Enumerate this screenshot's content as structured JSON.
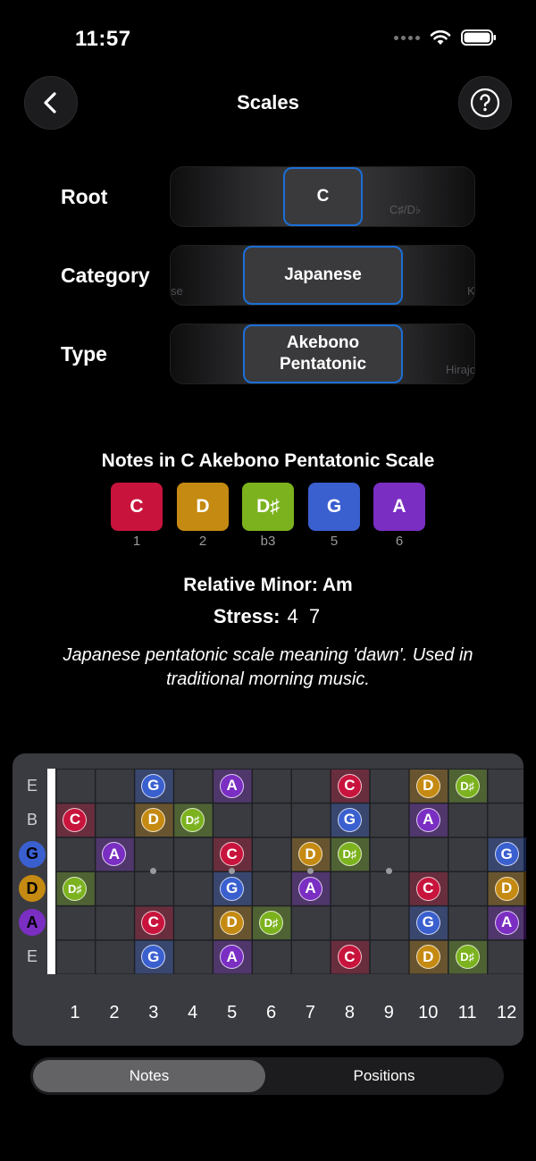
{
  "status": {
    "time": "11:57"
  },
  "nav": {
    "title": "Scales"
  },
  "pickers": [
    {
      "label": "Root",
      "value": "C",
      "next": "C♯/D♭"
    },
    {
      "label": "Category",
      "value": "Japanese",
      "prev": "se",
      "next": "K"
    },
    {
      "label": "Type",
      "value": "Akebono Pentatonic",
      "next": "Hirajoshi"
    }
  ],
  "scale": {
    "title": "Notes in C Akebono Pentatonic Scale",
    "notes": [
      {
        "name": "C",
        "interval": "1",
        "color": "#c8143c"
      },
      {
        "name": "D",
        "interval": "2",
        "color": "#c58a12"
      },
      {
        "name": "D♯",
        "interval": "b3",
        "color": "#7bb21e"
      },
      {
        "name": "G",
        "interval": "5",
        "color": "#3a5fcf"
      },
      {
        "name": "A",
        "interval": "6",
        "color": "#7a2ec2"
      }
    ],
    "relative_minor": "Relative Minor: Am",
    "stress_label": "Stress:",
    "stress_values": "4 7",
    "description": "Japanese pentatonic scale meaning 'dawn'. Used in traditional morning music."
  },
  "fretboard": {
    "strings": [
      "E",
      "B",
      "G",
      "D",
      "A",
      "E"
    ],
    "string_highlight": [
      false,
      false,
      true,
      true,
      true,
      false
    ],
    "fret_numbers": [
      "1",
      "2",
      "3",
      "4",
      "5",
      "6",
      "7",
      "8",
      "9",
      "10",
      "11",
      "12"
    ],
    "inlays": [
      3,
      5,
      7,
      9
    ],
    "positions": [
      {
        "string": 0,
        "fret": 3,
        "note": "G"
      },
      {
        "string": 0,
        "fret": 5,
        "note": "A"
      },
      {
        "string": 0,
        "fret": 8,
        "note": "C"
      },
      {
        "string": 0,
        "fret": 10,
        "note": "D"
      },
      {
        "string": 0,
        "fret": 11,
        "note": "D♯"
      },
      {
        "string": 1,
        "fret": 1,
        "note": "C"
      },
      {
        "string": 1,
        "fret": 3,
        "note": "D"
      },
      {
        "string": 1,
        "fret": 4,
        "note": "D♯"
      },
      {
        "string": 1,
        "fret": 8,
        "note": "G"
      },
      {
        "string": 1,
        "fret": 10,
        "note": "A"
      },
      {
        "string": 2,
        "fret": 2,
        "note": "A"
      },
      {
        "string": 2,
        "fret": 5,
        "note": "C"
      },
      {
        "string": 2,
        "fret": 7,
        "note": "D"
      },
      {
        "string": 2,
        "fret": 8,
        "note": "D♯"
      },
      {
        "string": 2,
        "fret": 12,
        "note": "G"
      },
      {
        "string": 3,
        "fret": 1,
        "note": "D♯"
      },
      {
        "string": 3,
        "fret": 5,
        "note": "G"
      },
      {
        "string": 3,
        "fret": 7,
        "note": "A"
      },
      {
        "string": 3,
        "fret": 10,
        "note": "C"
      },
      {
        "string": 3,
        "fret": 12,
        "note": "D"
      },
      {
        "string": 4,
        "fret": 3,
        "note": "C"
      },
      {
        "string": 4,
        "fret": 5,
        "note": "D"
      },
      {
        "string": 4,
        "fret": 6,
        "note": "D♯"
      },
      {
        "string": 4,
        "fret": 10,
        "note": "G"
      },
      {
        "string": 4,
        "fret": 12,
        "note": "A"
      },
      {
        "string": 5,
        "fret": 3,
        "note": "G"
      },
      {
        "string": 5,
        "fret": 5,
        "note": "A"
      },
      {
        "string": 5,
        "fret": 8,
        "note": "C"
      },
      {
        "string": 5,
        "fret": 10,
        "note": "D"
      },
      {
        "string": 5,
        "fret": 11,
        "note": "D♯"
      }
    ]
  },
  "segmented": {
    "notes_label": "Notes",
    "positions_label": "Positions",
    "selected": "Notes"
  }
}
